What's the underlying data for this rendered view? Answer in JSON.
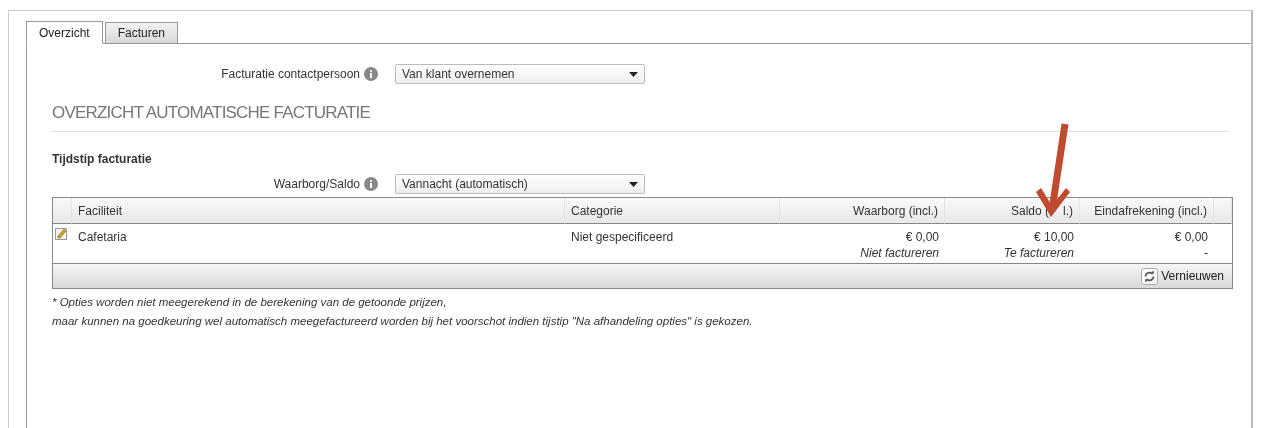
{
  "tabs": [
    {
      "label": "Overzicht",
      "selected": true
    },
    {
      "label": "Facturen",
      "selected": false
    }
  ],
  "contact_field": {
    "label": "Facturatie contactpersoon",
    "value": "Van klant overnemen"
  },
  "section_title": "OVERZICHT AUTOMATISCHE FACTURATIE",
  "subsection_title": "Tijdstip facturatie",
  "timing_field": {
    "label": "Waarborg/Saldo",
    "value": "Vannacht (automatisch)"
  },
  "table": {
    "columns": [
      "Faciliteit",
      "Categorie",
      "Waarborg (incl.)",
      "Saldo (",
      "Eindafrekening (incl.)"
    ],
    "rows": [
      {
        "facility": "Cafetaria",
        "category": "Niet gespecificeerd",
        "deposit": "€ 0,00",
        "deposit_note": "Niet factureren",
        "balance": "€ 10,00",
        "balance_note": "Te factureren",
        "final": "€ 0,00",
        "final_note": "-"
      }
    ],
    "refresh_button": "Vernieuwen",
    "saldo_header_visible_tail": "l.)"
  },
  "footnote_lines": [
    "* Opties worden niet meegerekend in de berekening van de getoonde prijzen,",
    "maar kunnen na goedkeuring wel automatisch meegefactureerd worden bij het voorschot indien tijstip \"Na afhandeling opties\" is gekozen."
  ]
}
